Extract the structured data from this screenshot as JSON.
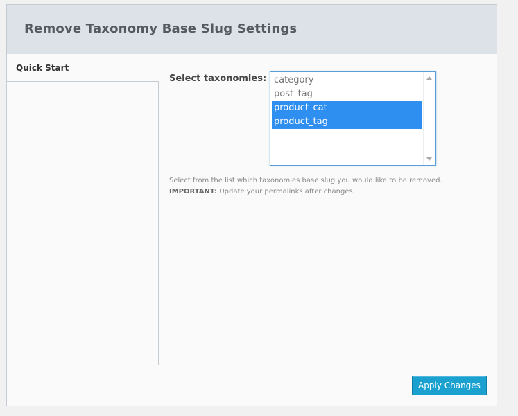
{
  "header": {
    "title": "Remove Taxonomy Base Slug Settings"
  },
  "sidebar": {
    "tabs": [
      {
        "label": "Quick Start",
        "active": true
      }
    ]
  },
  "form": {
    "label": "Select taxonomies:",
    "options": [
      {
        "label": "category",
        "selected": false
      },
      {
        "label": "post_tag",
        "selected": false
      },
      {
        "label": "product_cat",
        "selected": true
      },
      {
        "label": "product_tag",
        "selected": true
      }
    ],
    "help_text": "Select from the list which taxonomies base slug you would like to be removed.",
    "important_label": "IMPORTANT:",
    "important_text": " Update your permalinks after changes."
  },
  "footer": {
    "apply_label": "Apply Changes"
  },
  "colors": {
    "accent": "#1ba1cf",
    "selection": "#2e8ff0",
    "header_bg": "#dde2e9"
  }
}
